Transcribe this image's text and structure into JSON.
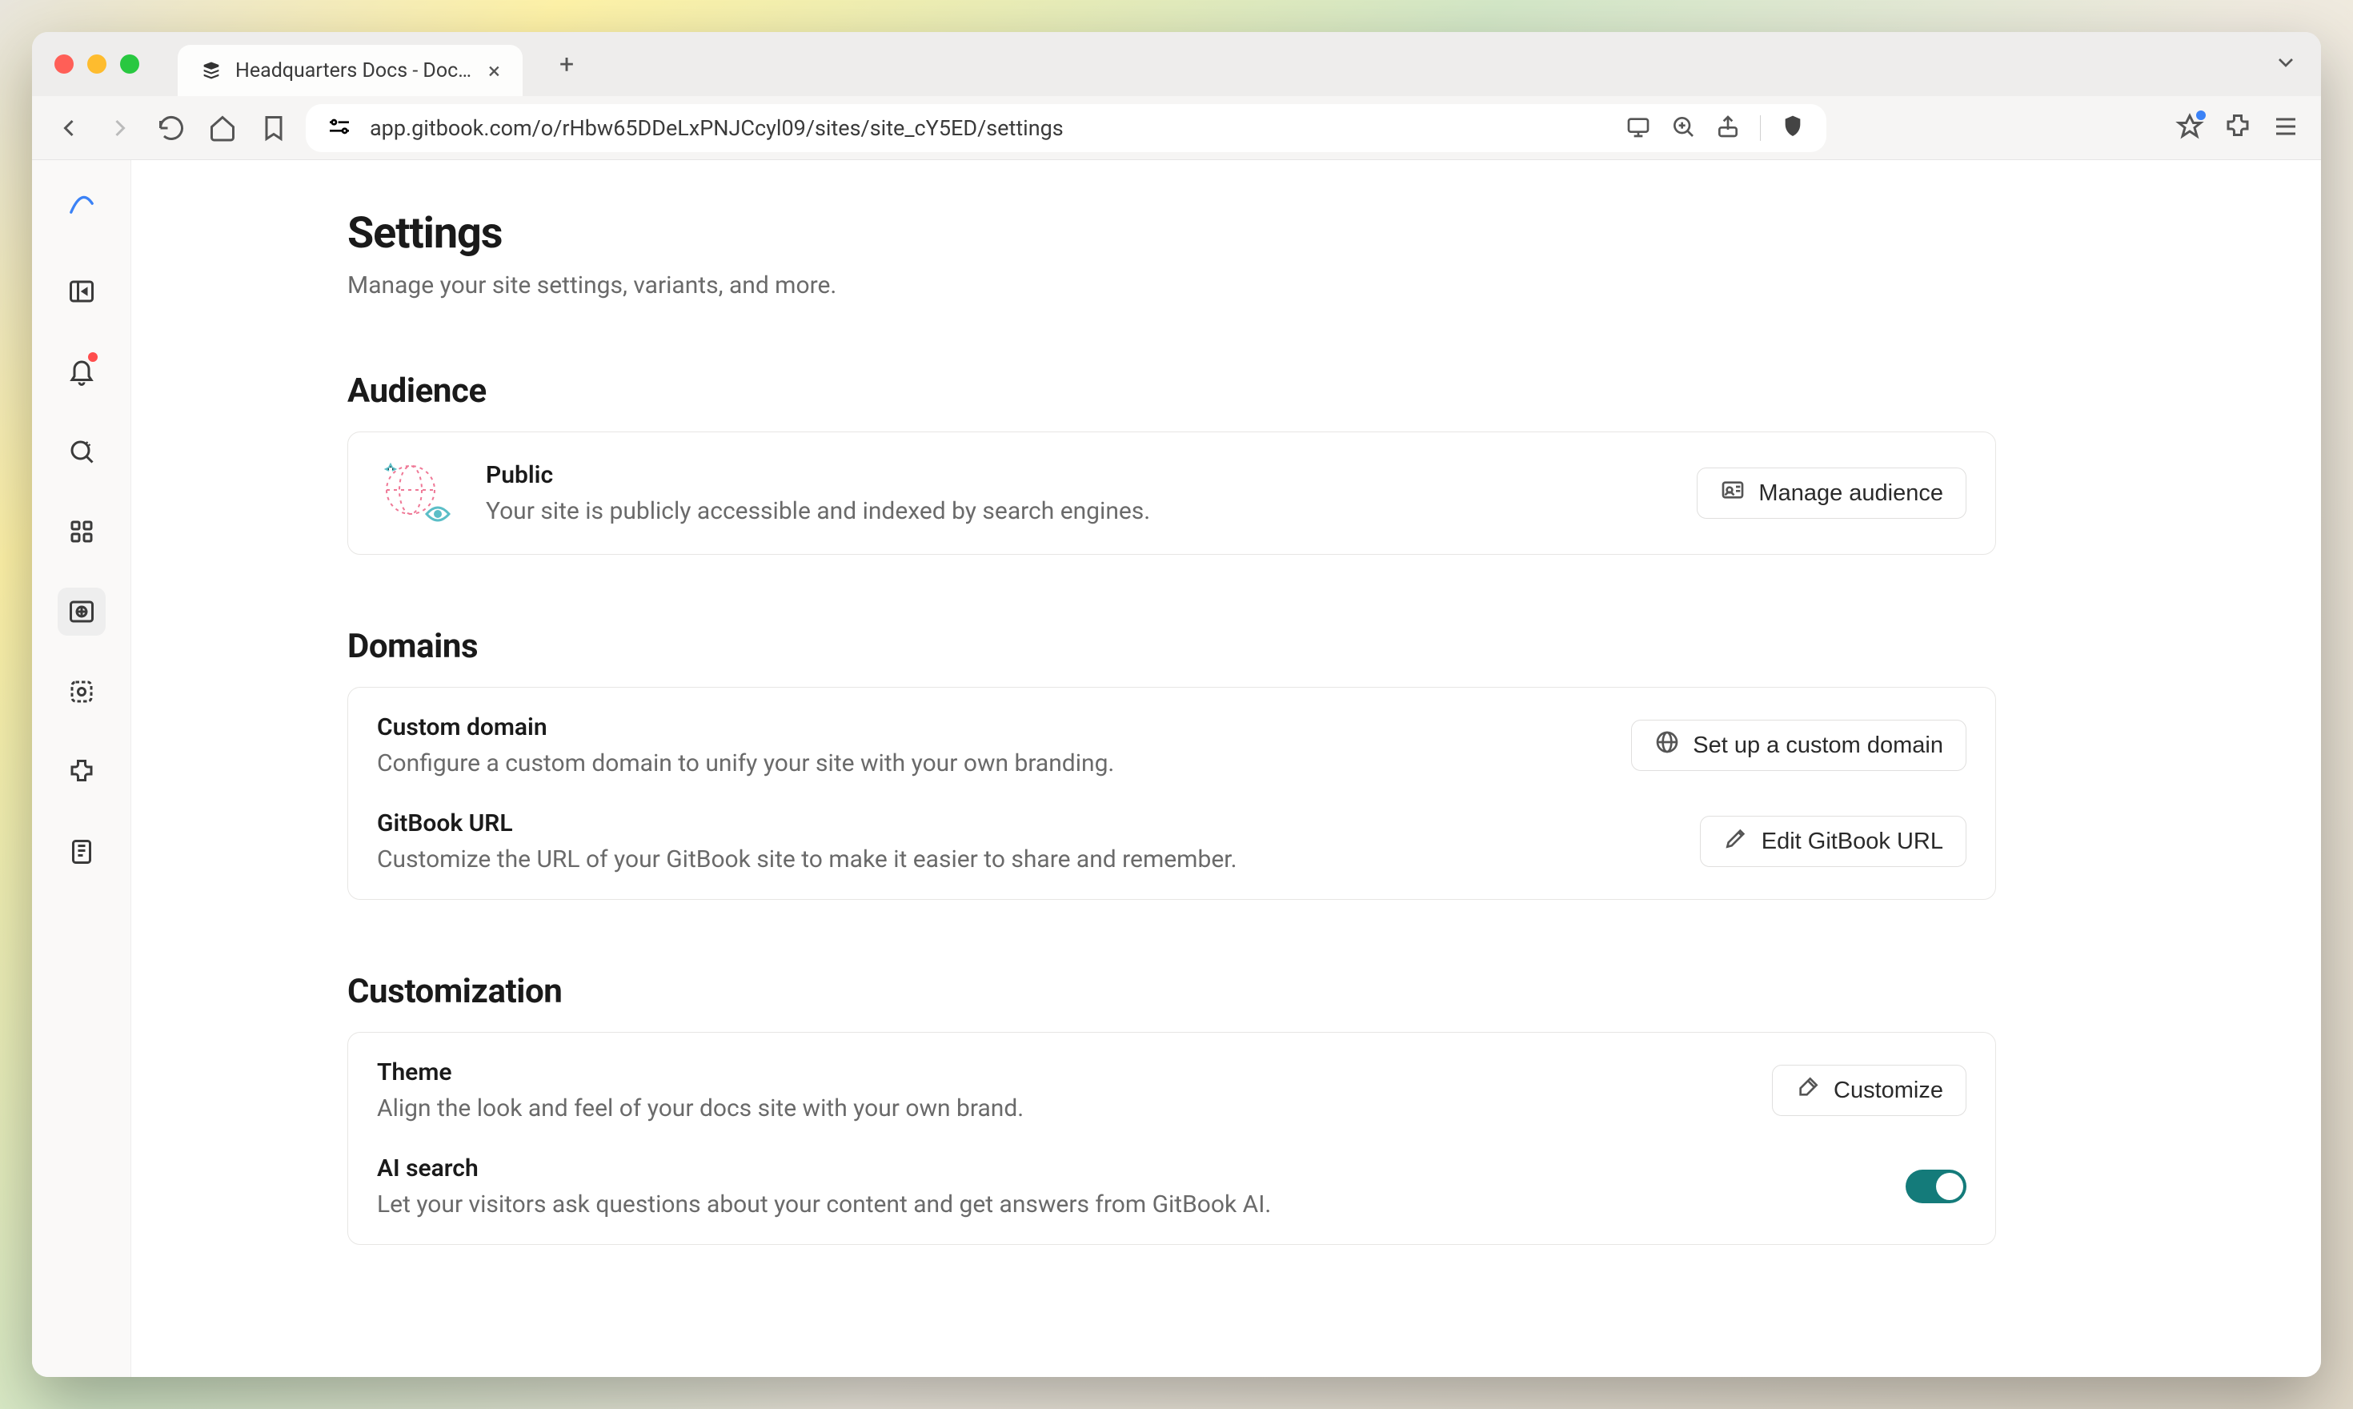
{
  "browser": {
    "tab_title": "Headquarters Docs - Docs si",
    "url": "app.gitbook.com/o/rHbw65DDeLxPNJCcyl09/sites/site_cY5ED/settings"
  },
  "page": {
    "title": "Settings",
    "subtitle": "Manage your site settings, variants, and more."
  },
  "sections": {
    "audience": {
      "title": "Audience",
      "item_label": "Public",
      "item_desc": "Your site is publicly accessible and indexed by search engines.",
      "action": "Manage audience"
    },
    "domains": {
      "title": "Domains",
      "custom_label": "Custom domain",
      "custom_desc": "Configure a custom domain to unify your site with your own branding.",
      "custom_action": "Set up a custom domain",
      "gitbook_label": "GitBook URL",
      "gitbook_desc": "Customize the URL of your GitBook site to make it easier to share and remember.",
      "gitbook_action": "Edit GitBook URL"
    },
    "customization": {
      "title": "Customization",
      "theme_label": "Theme",
      "theme_desc": "Align the look and feel of your docs site with your own brand.",
      "theme_action": "Customize",
      "ai_label": "AI search",
      "ai_desc": "Let your visitors ask questions about your content and get answers from GitBook AI."
    }
  }
}
